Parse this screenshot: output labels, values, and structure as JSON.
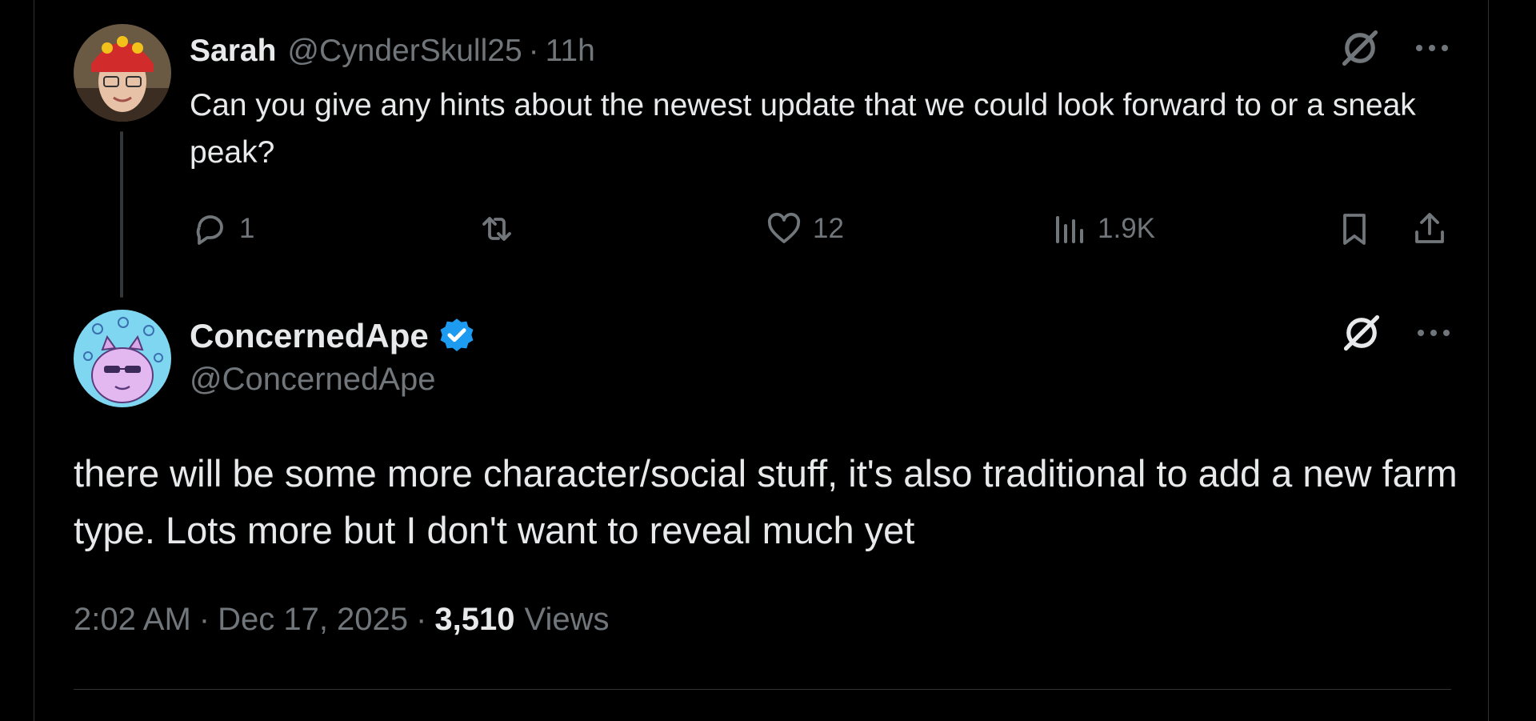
{
  "reply": {
    "author_name": "Sarah",
    "author_handle": "@CynderSkull25",
    "separator": "·",
    "time": "11h",
    "text": "Can you give any hints about the newest update that we could look forward to or a sneak peak?",
    "actions": {
      "replies": "1",
      "reposts": "",
      "likes": "12",
      "views": "1.9K"
    }
  },
  "main_post": {
    "author_name": "ConcernedApe",
    "author_handle": "@ConcernedApe",
    "verified": true,
    "text": "there will be some more character/social stuff, it's also traditional to add a new farm type. Lots more but I don't want to reveal much yet",
    "time": "2:02 AM",
    "date": "Dec 17, 2025",
    "separator": "·",
    "views_count": "3,510",
    "views_label": "Views"
  },
  "icons": {
    "grok": "grok-icon",
    "more": "more-icon",
    "reply": "reply-icon",
    "repost": "repost-icon",
    "like": "heart-icon",
    "views": "analytics-icon",
    "bookmark": "bookmark-icon",
    "share": "share-icon",
    "verified": "verified-badge-icon"
  },
  "colors": {
    "background": "#000000",
    "text_primary": "#e7e9ea",
    "text_secondary": "#71767b",
    "verified_blue": "#1d9bf0",
    "border": "#2f3336"
  }
}
